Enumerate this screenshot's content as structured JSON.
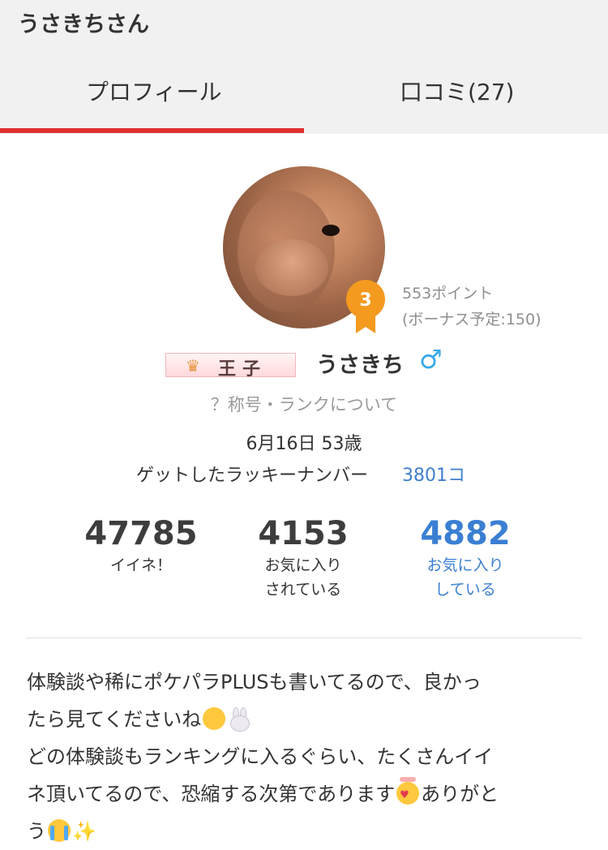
{
  "header": {
    "title": "うさきちさん",
    "tabs": [
      {
        "label": "プロフィール",
        "active": true
      },
      {
        "label": "口コミ(27)",
        "active": false
      }
    ]
  },
  "profile": {
    "rank_number": "3",
    "points": "553ポイント",
    "bonus": "(ボーナス予定:150)",
    "title_badge": "王子",
    "username": "うさきち",
    "gender_icon": "♂",
    "rank_link": "？称号・ランクについて",
    "birthday": "6月16日 53歳",
    "lucky_label": "ゲットしたラッキーナンバー",
    "lucky_value": "3801コ"
  },
  "stats": [
    {
      "value": "47785",
      "label_line1": "イイネ！",
      "label_line2": ""
    },
    {
      "value": "4153",
      "label_line1": "お気に入り",
      "label_line2": "されている"
    },
    {
      "value": "4882",
      "label_line1": "お気に入り",
      "label_line2": "している"
    }
  ],
  "bio": {
    "line1": "体験談や稀にポケパラPLUSも書いてるので、良かっ",
    "line2": "たら見てくださいね",
    "line3": "どの体験談もランキングに入るぐらい、たくさんイイ",
    "line4": "ネ頂いてるので、恐縮する次第であります",
    "line4_end": "ありがと",
    "line5": "う",
    "emojis": [
      "smiling-face-emoji",
      "rabbit-face-emoji",
      "smiling-face-with-hearts-emoji",
      "crying-face-emoji",
      "sparkles-emoji"
    ]
  },
  "colors": {
    "accent_red": "#e03030",
    "link_blue": "#3a7fd3",
    "rank_orange": "#f39a1f",
    "gender_blue": "#3aa8e8"
  }
}
